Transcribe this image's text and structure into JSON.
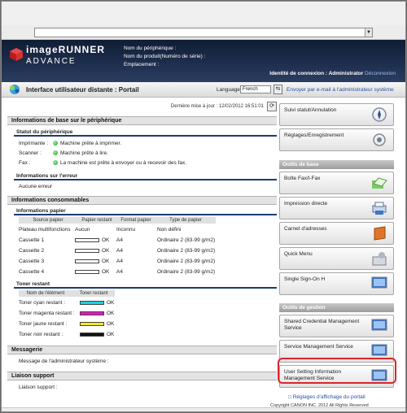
{
  "header": {
    "brand_line1": "imageRUNNER",
    "brand_line2": "ADVANCE",
    "device_name_label": "Nom du périphérique :",
    "device_serial_label": "Nom du produit(Numéro de série) :",
    "device_location_label": "Emplacement :",
    "login_label": "Identité de connexion : Administrator",
    "logout_label": "Déconnexion"
  },
  "titlebar": {
    "title": "Interface utilisateur distante : Portail",
    "language_label": "Language :",
    "language_value": "French",
    "mail_link": "Envoyer par e-mail à l'administrateur système"
  },
  "main": {
    "updated": "Dernière mise à jour : 12/02/2012 16:51:01",
    "basic_info_title": "Informations de base sur le périphérique",
    "device_status_title": "Statut du périphérique",
    "status_rows": [
      {
        "label": "Imprimante :",
        "value": "Machine prête à imprimer."
      },
      {
        "label": "Scanner :",
        "value": "Machine prête à lire."
      },
      {
        "label": "Fax :",
        "value": "La machine est prête à envoyer ou à recevoir des fax."
      }
    ],
    "error_title": "Informations sur l'erreur",
    "error_value": "Aucune erreur",
    "consumables_title": "Informations consommables",
    "paper_title": "Informations papier",
    "paper_headers": [
      "Source papier",
      "Papier restant",
      "Format papier",
      "Type de papier"
    ],
    "paper_rows": [
      {
        "source": "Plateau multifonctions",
        "remaining": "Aucun",
        "size": "Inconnu",
        "type": "Non défini",
        "bar": false
      },
      {
        "source": "Cassette 1",
        "remaining": "OK",
        "size": "A4",
        "type": "Ordinaire 2 (83-99 g/m2)",
        "bar": true
      },
      {
        "source": "Cassette 2",
        "remaining": "OK",
        "size": "A4",
        "type": "Ordinaire 2 (83-99 g/m2)",
        "bar": true
      },
      {
        "source": "Cassette 3",
        "remaining": "OK",
        "size": "A4",
        "type": "Ordinaire 2 (83-99 g/m2)",
        "bar": true
      },
      {
        "source": "Cassette 4",
        "remaining": "OK",
        "size": "A4",
        "type": "Ordinaire 2 (83-99 g/m2)",
        "bar": true
      }
    ],
    "toner_title": "Toner restant",
    "toner_headers": [
      "Nom de l'élément",
      "Toner restant"
    ],
    "toner_rows": [
      {
        "name": "Toner cyan restant :",
        "value": "OK",
        "color": "#19d3e6"
      },
      {
        "name": "Toner magenta restant :",
        "value": "OK",
        "color": "#e01ac0"
      },
      {
        "name": "Toner jaune restant :",
        "value": "OK",
        "color": "#f3ea16"
      },
      {
        "name": "Toner noir restant :",
        "value": "OK",
        "color": "#111111"
      }
    ],
    "messaging_title": "Messagerie",
    "messaging_value": "Message de l'administrateur système :",
    "support_title": "Liaison support",
    "support_value": "Liaison support :"
  },
  "side": {
    "status_card": "Suivi statut/Annulation",
    "settings_card": "Réglages/Enregistrement",
    "basic_tools_title": "Outils de base",
    "basic_tools": [
      "Boîte Fax/I-Fax",
      "Impression directe",
      "Carnet d'adresses",
      "Quick Menu",
      "Single Sign-On H"
    ],
    "mgmt_title": "Outils de gestion",
    "mgmt_tools": [
      "Shared Credential Management Service",
      "Service Management Service",
      "User Setting Information Management Service"
    ],
    "footer_link": "Réglages d'affichage du portail",
    "copyright": "Copyright CANON INC. 2012 All Rights Reserved"
  },
  "colors": {
    "banner": "#1f2f4f",
    "link": "#2351a6",
    "highlight": "#d8262e",
    "status_ok": "#1c9d2c"
  }
}
